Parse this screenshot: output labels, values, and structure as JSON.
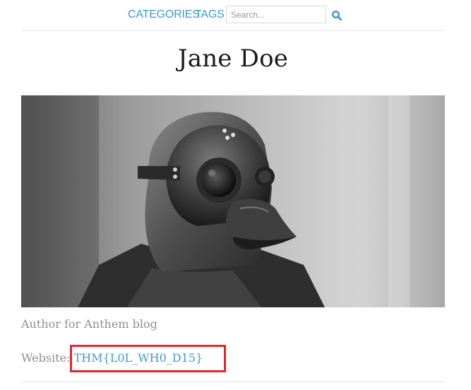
{
  "nav": {
    "categories_label": "CATEGORIES",
    "tags_label": "TAGS",
    "search_placeholder": "Search...",
    "search_icon": "search-icon",
    "link_color": "#3b9bd0"
  },
  "page": {
    "title": "Jane Doe"
  },
  "author": {
    "photo_icon": "plague-doctor-mask-photo",
    "description": "Author for Anthem blog",
    "website_label": "Website:",
    "website_value": "THM{L0L_WH0_D15}"
  },
  "colors": {
    "highlight": "#e3262b",
    "muted_text": "#8a8f94"
  }
}
